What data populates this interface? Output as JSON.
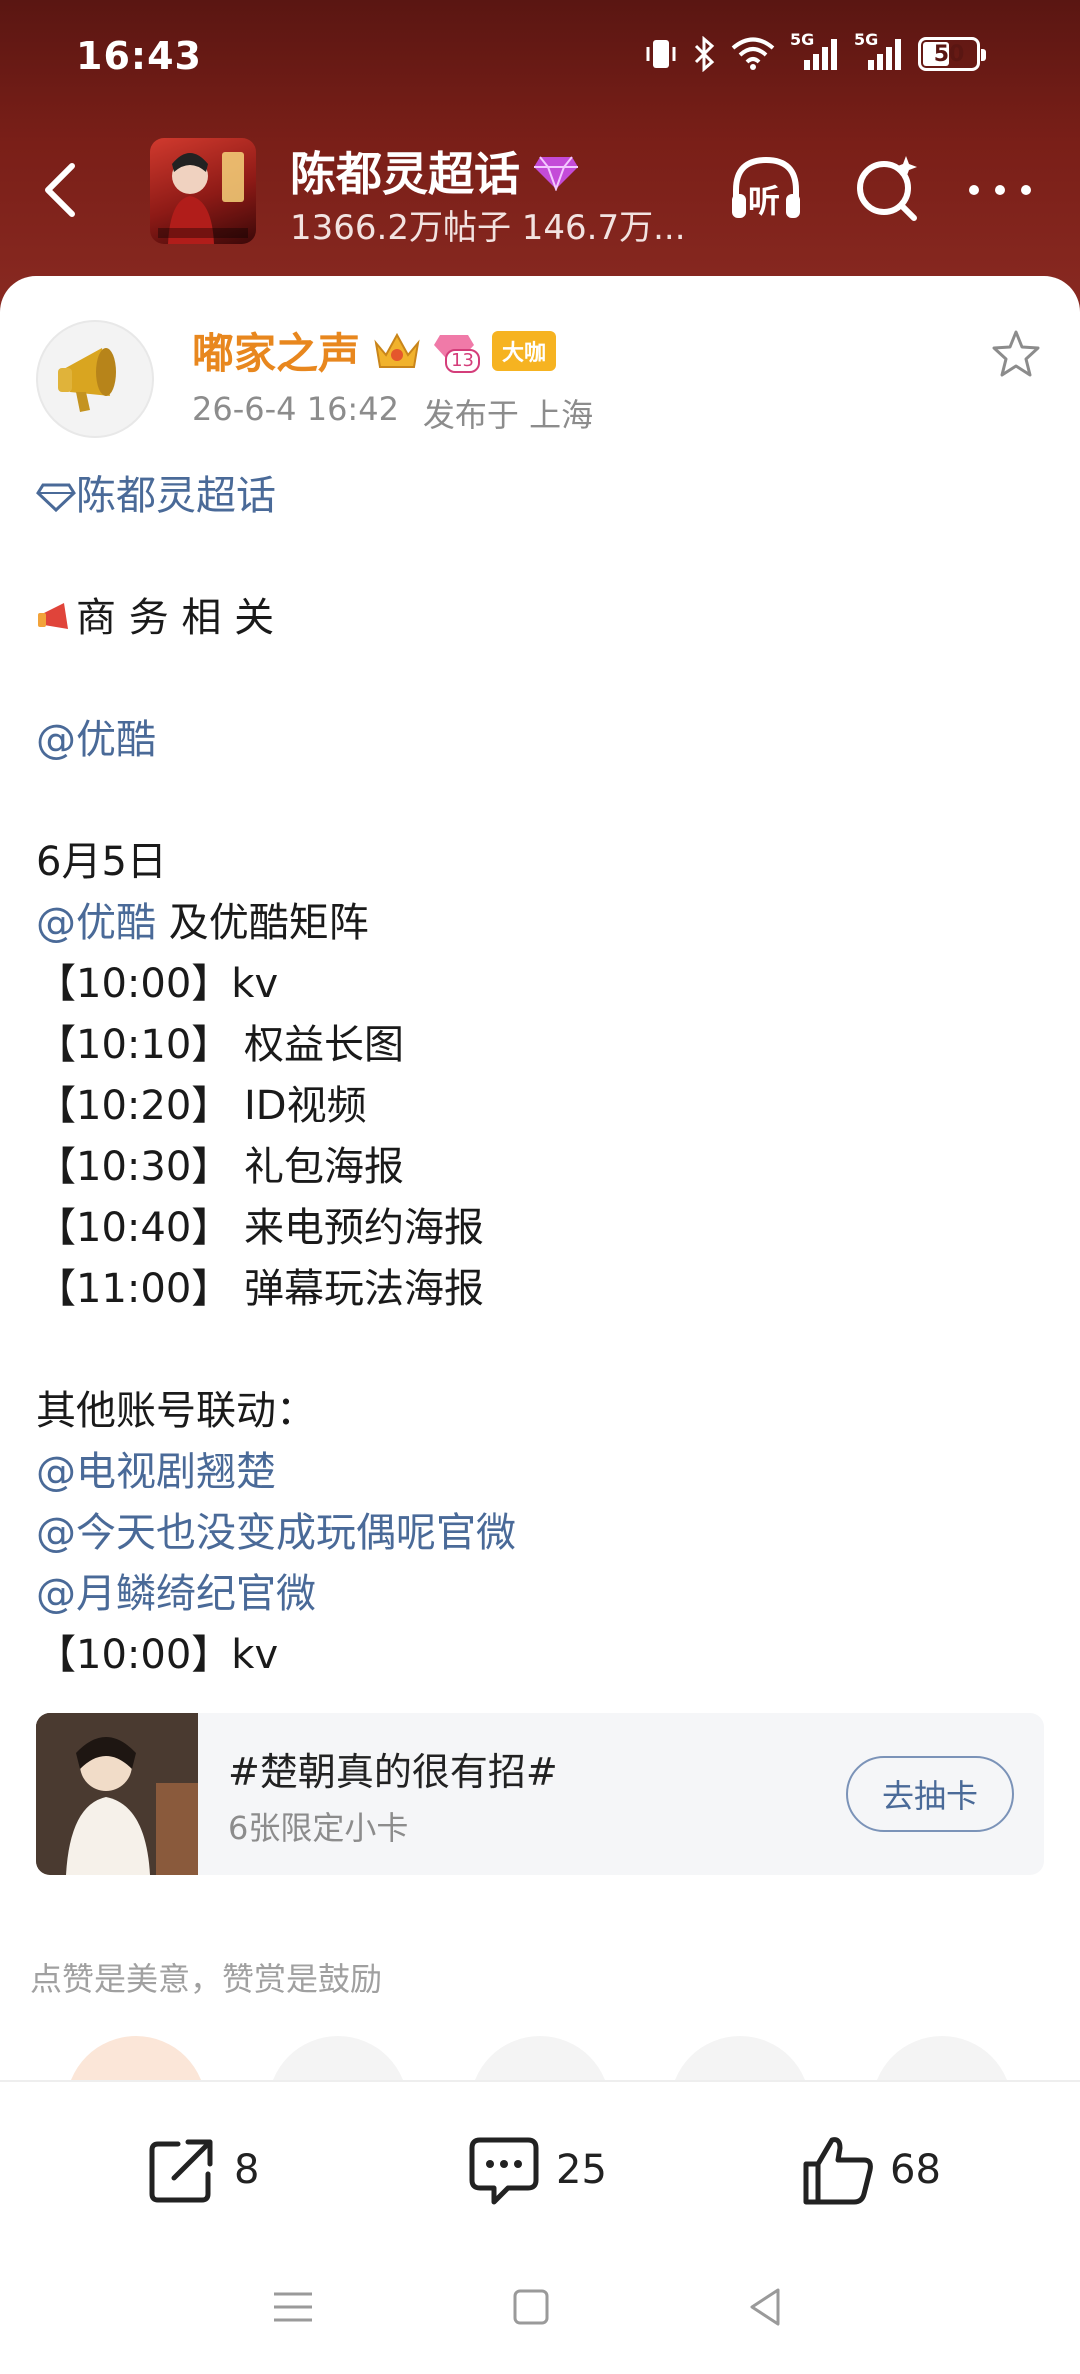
{
  "status_bar": {
    "time": "16:43",
    "battery": "50",
    "network_label_1": "5G",
    "network_label_2": "5G"
  },
  "header": {
    "topic_name": "陈都灵超话",
    "topic_stats": "1366.2万帖子 146.7万...",
    "icons": [
      "back-arrow-icon",
      "headphones-listen-icon",
      "search-icon",
      "more-icon"
    ],
    "listen_label": "听",
    "bg_color": "#7a1f18"
  },
  "author": {
    "name": "嘟家之声",
    "badge_label": "大咖",
    "level": "13",
    "timestamp": "26-6-4 16:42",
    "location": "发布于 上海",
    "name_color": "#e8871e"
  },
  "post": {
    "topic_link": "陈都灵超话",
    "section_title": "商 务 相 关",
    "mention_1": "@优酷",
    "date_line": "6月5日",
    "mention_2": "@优酷",
    "matrix_text": " 及优酷矩阵",
    "schedule": [
      {
        "time": "【10:00】",
        "item": "kv"
      },
      {
        "time": "【10:10】",
        "item": " 权益长图"
      },
      {
        "time": "【10:20】",
        "item": " ID视频"
      },
      {
        "time": "【10:30】",
        "item": " 礼包海报"
      },
      {
        "time": "【10:40】",
        "item": " 来电预约海报"
      },
      {
        "time": "【11:00】",
        "item": " 弹幕玩法海报"
      }
    ],
    "other_accounts_label": "其他账号联动：",
    "other_mentions": [
      "@电视剧翘楚",
      "@今天也没变成玩偶呢官微",
      "@月鳞绮纪官微"
    ],
    "final_time": "【10:00】",
    "final_item": "kv",
    "link_color": "#4a6a98"
  },
  "promo": {
    "title": "#楚朝真的很有招#",
    "subtitle": "6张限定小卡",
    "button": "去抽卡"
  },
  "reward": {
    "tip": "点赞是美意，赞赏是鼓励"
  },
  "actions": {
    "share_count": "8",
    "comment_count": "25",
    "like_count": "68"
  }
}
